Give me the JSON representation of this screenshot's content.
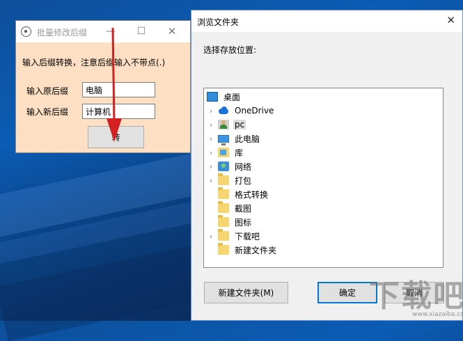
{
  "app": {
    "title": "批量修改后缀",
    "hint": "输入后缀转换，注意后缀输入不带点(.)",
    "old_suffix_label": "输入原后缀",
    "old_suffix_value": "电脑",
    "new_suffix_label": "输入新后缀",
    "new_suffix_value": "计算机",
    "convert_label": "转",
    "min_glyph": "—",
    "max_glyph": "☐",
    "close_glyph": "✕"
  },
  "dialog": {
    "title": "浏览文件夹",
    "close_glyph": "✕",
    "prompt": "选择存放位置:",
    "tree": [
      {
        "label": "桌面",
        "icon": "desktop-icon",
        "expandable": false,
        "indent": 0
      },
      {
        "label": "OneDrive",
        "icon": "cloud-icon",
        "expandable": true,
        "indent": 1
      },
      {
        "label": "pc",
        "icon": "user-icon",
        "expandable": true,
        "indent": 1,
        "selected": true
      },
      {
        "label": "此电脑",
        "icon": "computer-icon",
        "expandable": true,
        "indent": 1
      },
      {
        "label": "库",
        "icon": "library-icon",
        "expandable": true,
        "indent": 1
      },
      {
        "label": "网络",
        "icon": "network-icon",
        "expandable": true,
        "indent": 1
      },
      {
        "label": "打包",
        "icon": "folder-icon",
        "expandable": true,
        "indent": 1
      },
      {
        "label": "格式转换",
        "icon": "folder-icon",
        "expandable": false,
        "indent": 1
      },
      {
        "label": "截图",
        "icon": "folder-icon",
        "expandable": false,
        "indent": 1
      },
      {
        "label": "图标",
        "icon": "folder-icon",
        "expandable": false,
        "indent": 1
      },
      {
        "label": "下载吧",
        "icon": "folder-icon",
        "expandable": true,
        "indent": 1
      },
      {
        "label": "新建文件夹",
        "icon": "folder-icon",
        "expandable": false,
        "indent": 1
      }
    ],
    "new_folder_label": "新建文件夹(M)",
    "ok_label": "确定",
    "cancel_label": "取消"
  },
  "watermark": {
    "text": "下载吧",
    "subtext": "www.xiazaiba.com"
  },
  "colors": {
    "app_background": "#fde0c4",
    "dialog_background": "#f0f0f0",
    "arrow": "#d42020",
    "ok_border": "#0078d7"
  }
}
